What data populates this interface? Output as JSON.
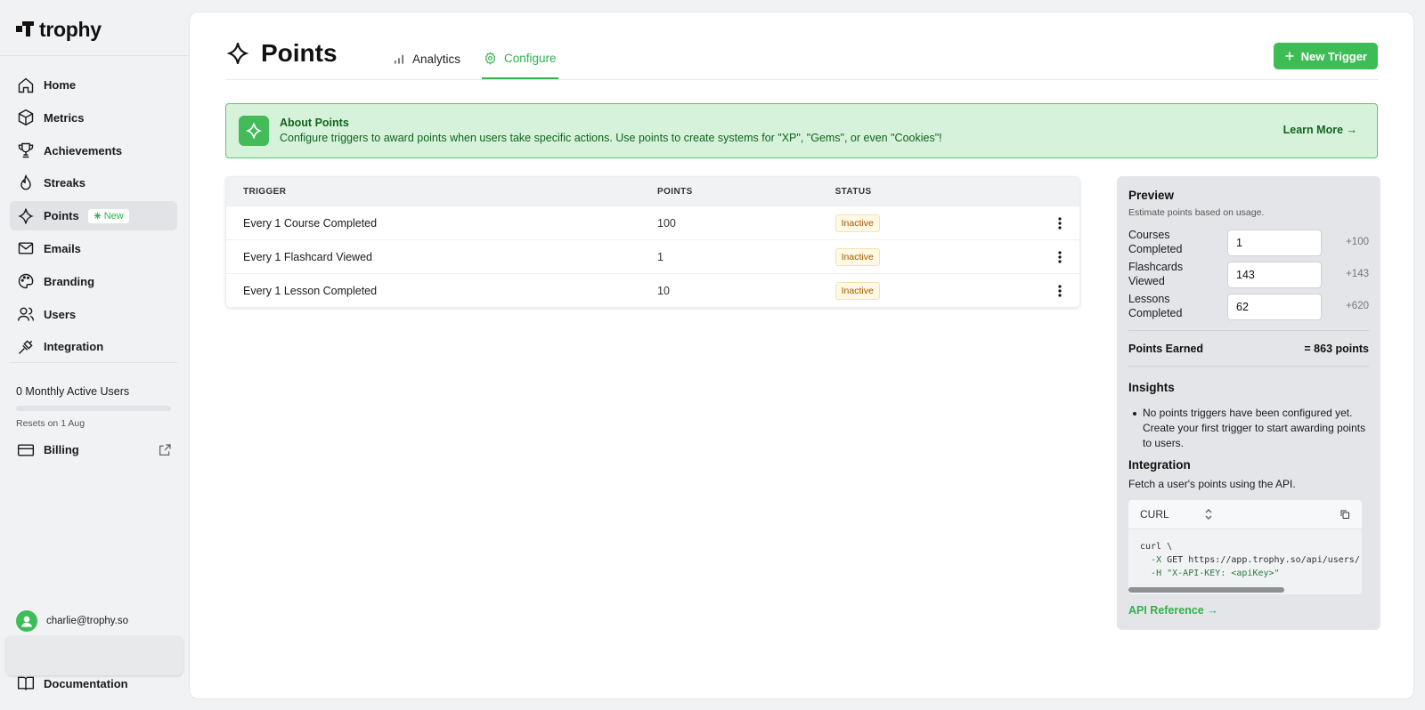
{
  "brand": {
    "name": "trophy"
  },
  "nav": {
    "items": [
      {
        "label": "Home",
        "icon": "home-icon"
      },
      {
        "label": "Metrics",
        "icon": "cube-icon"
      },
      {
        "label": "Achievements",
        "icon": "trophy-icon"
      },
      {
        "label": "Streaks",
        "icon": "flame-icon"
      },
      {
        "label": "Points",
        "icon": "sparkle-icon",
        "badge": "New",
        "active": true
      },
      {
        "label": "Emails",
        "icon": "mail-icon"
      },
      {
        "label": "Branding",
        "icon": "palette-icon"
      },
      {
        "label": "Users",
        "icon": "users-icon"
      },
      {
        "label": "Integration",
        "icon": "plug-icon"
      }
    ],
    "mau_label": "0 Monthly Active Users",
    "mau_fraction": 0,
    "resets": "Resets on 1 Aug",
    "billing": "Billing",
    "user_email": "charlie@trophy.so",
    "documentation": "Documentation"
  },
  "header": {
    "title": "Points",
    "tabs": [
      {
        "label": "Analytics",
        "icon": "bar-chart-icon"
      },
      {
        "label": "Configure",
        "icon": "gear-icon",
        "active": true
      }
    ],
    "new_trigger": "New Trigger"
  },
  "banner": {
    "title": "About Points",
    "description": "Configure triggers to award points when users take specific actions. Use points to create systems for \"XP\", \"Gems\", or even \"Cookies\"!",
    "link": "Learn More →"
  },
  "table": {
    "columns": [
      "TRIGGER",
      "POINTS",
      "STATUS"
    ],
    "rows": [
      {
        "trigger": "Every 1 Course Completed",
        "points": "100",
        "status": "Inactive"
      },
      {
        "trigger": "Every 1 Flashcard Viewed",
        "points": "1",
        "status": "Inactive"
      },
      {
        "trigger": "Every 1 Lesson Completed",
        "points": "10",
        "status": "Inactive"
      }
    ]
  },
  "preview": {
    "title": "Preview",
    "subtitle": "Estimate points based on usage.",
    "inputs": [
      {
        "label": "Courses Completed",
        "value": "1",
        "result": "+100"
      },
      {
        "label": "Flashcards Viewed",
        "value": "143",
        "result": "+143"
      },
      {
        "label": "Lessons Completed",
        "value": "62",
        "result": "+620"
      }
    ],
    "earned_label": "Points Earned",
    "earned_value": "= 863 points",
    "insights_title": "Insights",
    "insight": "No points triggers have been configured yet. Create your first trigger to start awarding points to users.",
    "integration_title": "Integration",
    "integration_desc": "Fetch a user's points using the API.",
    "code_lang": "CURL",
    "code_line1": "curl \\",
    "code_line2_flag": "-X",
    "code_line2_rest": " GET https://app.trophy.so/api/users/",
    "code_line3_flag": "-H",
    "code_line3_rest": " \"X-API-KEY: <apiKey>\"",
    "api_ref": "API Reference →"
  },
  "colors": {
    "accent": "#3ebc56",
    "banner_bg": "#d6f2da",
    "inactive": "#a25a00"
  }
}
